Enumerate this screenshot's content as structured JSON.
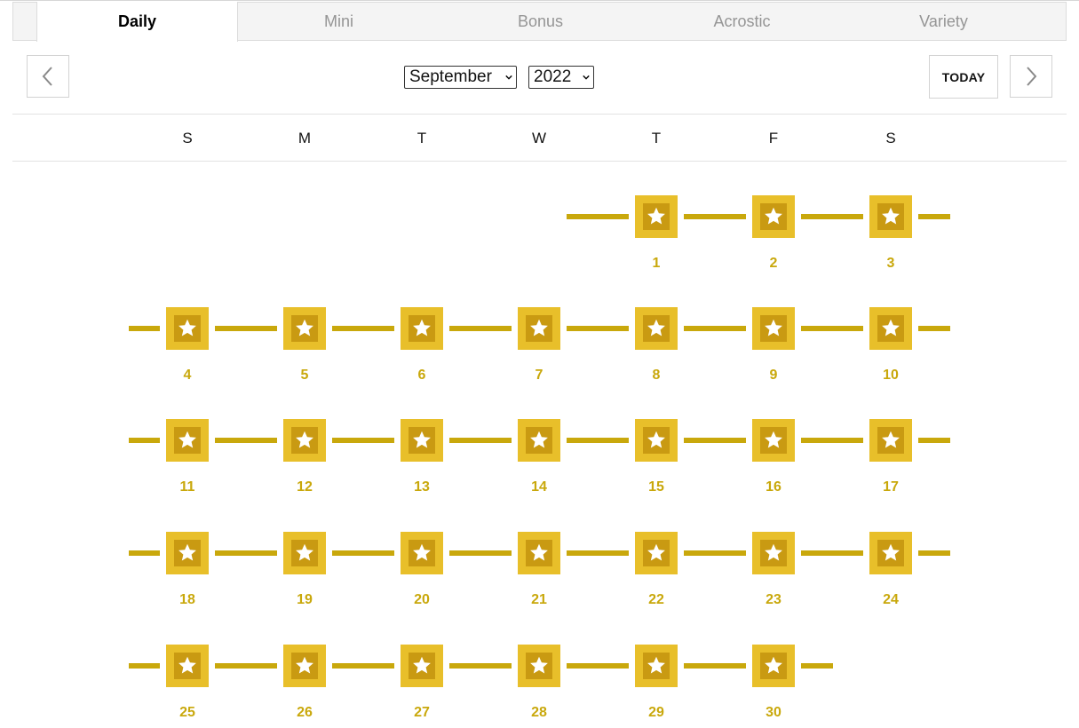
{
  "tabs": [
    {
      "label": "Daily",
      "active": true
    },
    {
      "label": "Mini",
      "active": false
    },
    {
      "label": "Bonus",
      "active": false
    },
    {
      "label": "Acrostic",
      "active": false
    },
    {
      "label": "Variety",
      "active": false
    }
  ],
  "nav": {
    "month_select": "September",
    "year_select": "2022",
    "today_label": "TODAY",
    "prev_icon": "chevron-left-icon",
    "next_icon": "chevron-right-icon"
  },
  "calendar": {
    "weekday_headers": [
      "S",
      "M",
      "T",
      "W",
      "T",
      "F",
      "S"
    ],
    "first_weekday_index": 4,
    "days_in_month": 30,
    "day_status": "solved-gold-star",
    "day_icon": "star-icon",
    "colors": {
      "gold_outer": "#e8bf2a",
      "gold_inner": "#c99a12",
      "connector": "#c9a80c",
      "day_number": "#c9a80c"
    }
  }
}
